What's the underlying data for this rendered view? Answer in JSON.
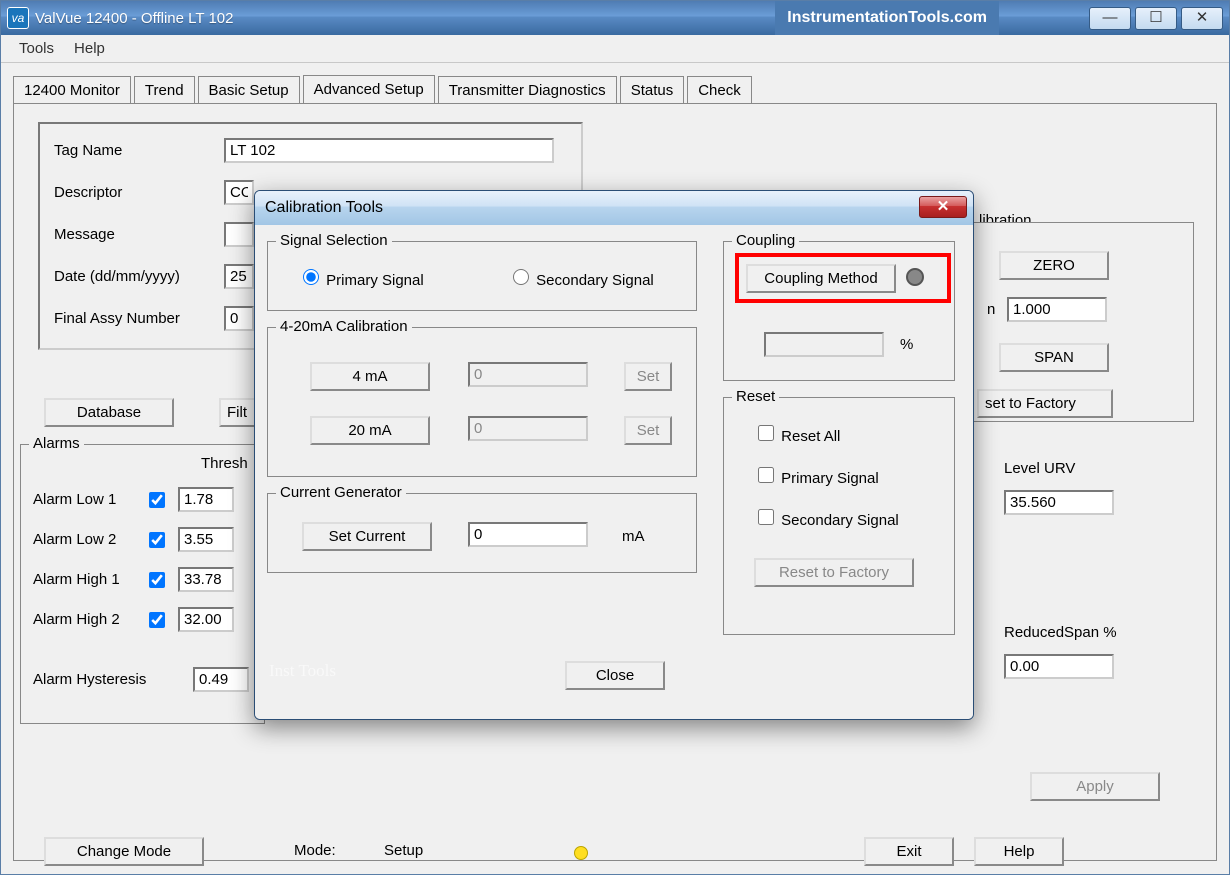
{
  "title_bar": {
    "app_icon_text": "va",
    "title": "ValVue 12400 - Offline  LT 102",
    "watermark": "InstrumentationTools.com",
    "min": "—",
    "max": "☐",
    "close": "✕"
  },
  "menu": {
    "tools": "Tools",
    "help": "Help"
  },
  "tabs": {
    "monitor": "12400 Monitor",
    "trend": "Trend",
    "basic": "Basic Setup",
    "advanced": "Advanced Setup",
    "tx_diag": "Transmitter Diagnostics",
    "status": "Status",
    "check": "Check"
  },
  "form": {
    "tag_name_label": "Tag Name",
    "tag_name_value": "LT 102",
    "descriptor_label": "Descriptor",
    "descriptor_value": "CO",
    "message_label": "Message",
    "message_value": "",
    "date_label": "Date (dd/mm/yyyy)",
    "date_value": "25",
    "final_assy_label": "Final Assy Number",
    "final_assy_value": "0",
    "database_btn": "Database",
    "filter_btn": "Filt"
  },
  "alarms": {
    "group": "Alarms",
    "thresh_header": "Thresh",
    "low1_label": "Alarm Low 1",
    "low1_val": "1.78",
    "low2_label": "Alarm Low 2",
    "low2_val": "3.55",
    "high1_label": "Alarm High 1",
    "high1_val": "33.78",
    "high2_label": "Alarm High 2",
    "high2_val": "32.00",
    "hyst_label": "Alarm Hysteresis",
    "hyst_val": "0.49"
  },
  "right_panel": {
    "group": "libration",
    "zero_btn": "ZERO",
    "span_btn": "SPAN",
    "factor_label": "n",
    "factor_val": "1.000",
    "reset_factory_btn": "set to Factory",
    "level_urv_label": "Level URV",
    "level_urv_val": "35.560",
    "reduced_span_label": "ReducedSpan %",
    "reduced_span_val": "0.00",
    "apply_btn": "Apply"
  },
  "bottom_bar": {
    "change_mode": "Change Mode",
    "mode_label": "Mode:",
    "mode_value": "Setup",
    "exit": "Exit",
    "help": "Help"
  },
  "dialog": {
    "title": "Calibration Tools",
    "close_x": "✕",
    "signal_selection": {
      "group": "Signal Selection",
      "primary": "Primary Signal",
      "secondary": "Secondary Signal"
    },
    "calib_4_20": {
      "group": "4-20mA Calibration",
      "btn_4ma": "4 mA",
      "btn_20ma": "20 mA",
      "val_4": "0",
      "val_20": "0",
      "set": "Set"
    },
    "current_gen": {
      "group": "Current Generator",
      "set_current": "Set Current",
      "value": "0",
      "unit": "mA"
    },
    "coupling": {
      "group": "Coupling",
      "method_btn": "Coupling Method",
      "pct_unit": "%",
      "pct_val": ""
    },
    "reset": {
      "group": "Reset",
      "reset_all": "Reset All",
      "primary": "Primary Signal",
      "secondary": "Secondary Signal",
      "reset_factory": "Reset to Factory"
    },
    "close_btn": "Close",
    "faint_wm": "Inst Tools"
  }
}
